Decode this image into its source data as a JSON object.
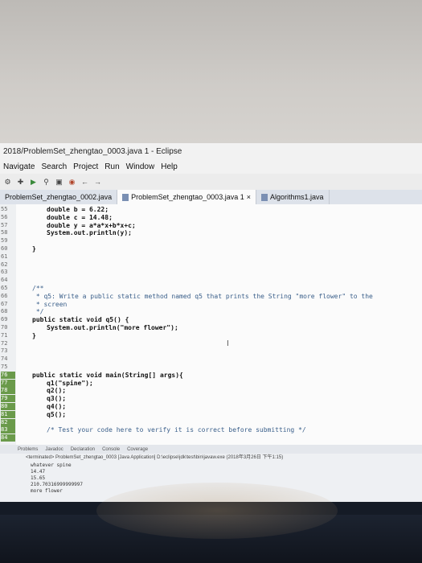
{
  "window": {
    "title": "2018/ProblemSet_zhengtao_0003.java 1 - Eclipse"
  },
  "menu": [
    "Navigate",
    "Search",
    "Project",
    "Run",
    "Window",
    "Help"
  ],
  "toolbar_icons": [
    "debug-icon",
    "new-icon",
    "run-icon",
    "search-icon",
    "open-type-icon",
    "external-tools-icon",
    "nav-back-icon",
    "nav-forward-icon"
  ],
  "tabs": [
    {
      "label": "ProblemSet_zhengtao_0002.java",
      "active": false
    },
    {
      "label": "ProblemSet_zhengtao_0003.java 1",
      "active": true,
      "close": "×"
    },
    {
      "label": "Algorithms1.java",
      "active": false
    }
  ],
  "editor": {
    "lines": [
      {
        "n": "55",
        "text": "double b = 6.22;",
        "indent": 1
      },
      {
        "n": "56",
        "text": "double c = 14.48;",
        "indent": 1
      },
      {
        "n": "57",
        "text": "double y = a*a*x+b*x+c;",
        "indent": 1
      },
      {
        "n": "58",
        "text": "System.out.println(y);",
        "indent": 1
      },
      {
        "n": "59",
        "text": "",
        "indent": 0
      },
      {
        "n": "60",
        "text": "}",
        "indent": 0
      },
      {
        "n": "61",
        "text": "",
        "indent": 0
      },
      {
        "n": "62",
        "text": "",
        "indent": 0
      },
      {
        "n": "63",
        "text": "",
        "indent": 0
      },
      {
        "n": "64",
        "text": "",
        "indent": 0
      },
      {
        "n": "65",
        "text": "/**",
        "indent": 0,
        "comment": true
      },
      {
        "n": "66",
        "text": " * q5: Write a public static method named q5 that prints the String \"more flower\" to the",
        "indent": 0,
        "comment": true
      },
      {
        "n": "67",
        "text": " * screen",
        "indent": 0,
        "comment": true
      },
      {
        "n": "68",
        "text": " */",
        "indent": 0,
        "comment": true
      },
      {
        "n": "69",
        "text": "public static void q5() {",
        "indent": 0
      },
      {
        "n": "70",
        "text": "System.out.println(\"more flower\");",
        "indent": 1
      },
      {
        "n": "71",
        "text": "}",
        "indent": 0
      },
      {
        "n": "72",
        "text": "",
        "indent": 0
      },
      {
        "n": "73",
        "text": "",
        "indent": 0
      },
      {
        "n": "74",
        "text": "",
        "indent": 0
      },
      {
        "n": "75",
        "text": "",
        "indent": 0
      },
      {
        "n": "76",
        "text": "public static void main(String[] args){",
        "indent": 0
      },
      {
        "n": "77",
        "text": "q1(\"spine\");",
        "indent": 1
      },
      {
        "n": "78",
        "text": "q2();",
        "indent": 1
      },
      {
        "n": "79",
        "text": "q3();",
        "indent": 1
      },
      {
        "n": "80",
        "text": "q4();",
        "indent": 1
      },
      {
        "n": "81",
        "text": "q5();",
        "indent": 1
      },
      {
        "n": "82",
        "text": "",
        "indent": 0
      },
      {
        "n": "83",
        "text": "/* Test your code here to verify it is correct before submitting */",
        "indent": 1,
        "comment": true
      },
      {
        "n": "84",
        "text": "",
        "indent": 0
      }
    ]
  },
  "console": {
    "tabs": [
      "Problems",
      "Javadoc",
      "Declaration",
      "Console",
      "Coverage"
    ],
    "status": "<terminated> ProblemSet_zhengtao_0003 [Java Application] D:\\eclipse\\jdk\\test\\bin\\javaw.exe (2018年3月26日 下午1:15)",
    "output": [
      "whatever spine",
      "14.47",
      "15.65",
      "210.70316999999997",
      "more flower"
    ]
  },
  "colors": {
    "screen_bg": "#eef0f3",
    "editor_bg": "#fbfbfb",
    "gutter_mark": "#6a9a4a",
    "comment": "#3a5f8a"
  }
}
